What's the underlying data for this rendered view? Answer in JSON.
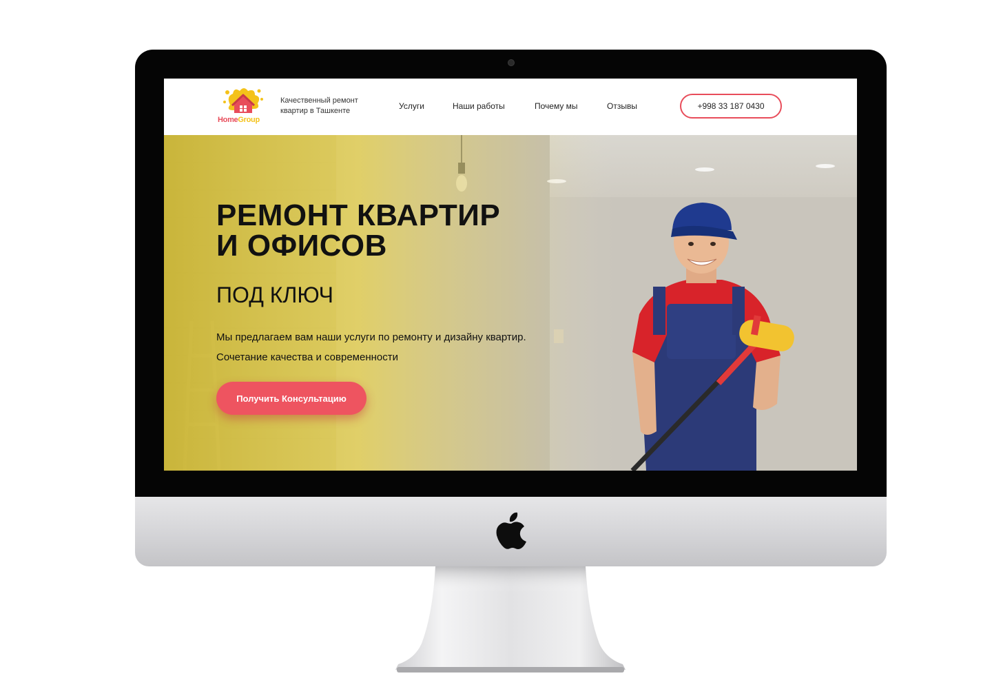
{
  "header": {
    "logo": {
      "part1": "Home",
      "part2": "Group"
    },
    "tagline": "Качественный ремонт квартир в Ташкенте",
    "nav": [
      {
        "label": "Услуги"
      },
      {
        "label": "Наши работы"
      },
      {
        "label": "Почему мы"
      },
      {
        "label": "Отзывы"
      }
    ],
    "phone": "+998 33 187 0430"
  },
  "hero": {
    "title_line1": "РЕМОНТ КВАРТИР",
    "title_line2": "И ОФИСОВ",
    "subtitle": "ПОД КЛЮЧ",
    "description": "Мы предлагаем вам наши услуги по ремонту и дизайну квартир. Сочетание качества и современности",
    "cta": "Получить Консультацию"
  },
  "colors": {
    "accent": "#ee5460",
    "brand_yellow": "#f4c21a",
    "hero_yellow": "#dcc84f"
  },
  "icons": [
    "apple-logo-icon",
    "home-group-logo-icon"
  ]
}
